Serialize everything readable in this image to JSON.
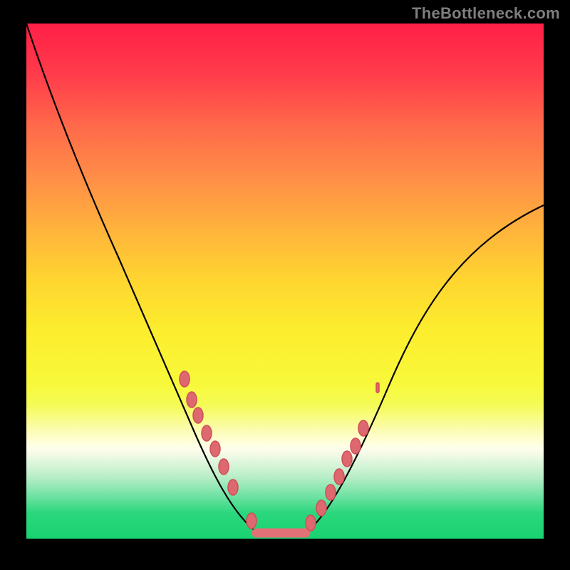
{
  "watermark": "TheBottleneck.com",
  "colors": {
    "curve": "#000000",
    "marker_fill": "#de6870",
    "marker_stroke": "#d04e56",
    "gradient_top": "#ff1f47",
    "gradient_bottom": "#18d270"
  },
  "chart_data": {
    "type": "line",
    "title": "",
    "xlabel": "",
    "ylabel": "",
    "xlim": [
      0,
      100
    ],
    "ylim": [
      0,
      100
    ],
    "series": [
      {
        "name": "bottleneck-curve",
        "x": [
          0,
          8,
          14,
          20,
          26,
          31,
          36,
          40,
          43,
          46,
          53,
          57,
          62,
          68,
          74,
          82,
          90,
          100
        ],
        "y": [
          100,
          80,
          65,
          52,
          40,
          30,
          20,
          11,
          5,
          1,
          1,
          5,
          12,
          22,
          32,
          44,
          54,
          64
        ]
      }
    ],
    "markers": {
      "name": "highlighted-points",
      "x": [
        30.5,
        32.0,
        33.2,
        34.8,
        36.5,
        38.2,
        40.0,
        43.5,
        46.0,
        49.0,
        52.0,
        55.0,
        57.0,
        58.8,
        60.5,
        62.0,
        63.6,
        65.2
      ],
      "y": [
        31.0,
        27.0,
        24.0,
        20.5,
        17.5,
        14.0,
        10.0,
        3.5,
        1.0,
        1.0,
        1.0,
        3.0,
        6.0,
        9.0,
        12.0,
        15.5,
        18.0,
        21.5
      ]
    },
    "flat_region": {
      "x_start": 44.5,
      "x_end": 54.0,
      "y": 0.8
    },
    "annotations": []
  }
}
